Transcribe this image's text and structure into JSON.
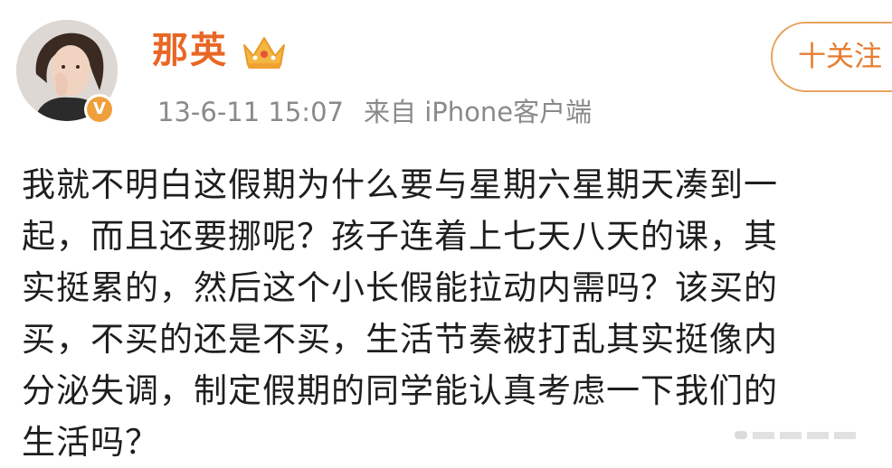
{
  "post": {
    "username": "那英",
    "timestamp": "13-6-11 15:07",
    "source_prefix": "来自",
    "source": "iPhone客户端",
    "follow_label": "十关注",
    "content_lines": [
      "我就不明白这假期为什么要与星期六星期天凑到一",
      "起，而且还要挪呢？孩子连着上七天八天的课，其",
      "实挺累的，然后这个小长假能拉动内需吗？该买的",
      "买，不买的还是不买，生活节奏被打乱其实挺像内",
      "分泌失调，制定假期的同学能认真考虑一下我们的",
      "生活吗？"
    ]
  },
  "colors": {
    "username": "#e86724",
    "follow_border": "#e8a35c",
    "meta_text": "#8a8a8a",
    "verified_badge": "#f0a03a"
  },
  "icons": {
    "avatar": "user-avatar",
    "verified": "verified-badge-icon",
    "crown": "crown-icon",
    "watermark": "weibo-watermark"
  }
}
